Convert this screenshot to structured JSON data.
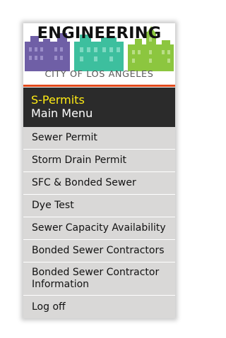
{
  "logo": {
    "word": "ENGINEERING",
    "city": "CITY OF LOS ANGELES",
    "colors": {
      "purple": "#6f5fa6",
      "teal": "#3dbf9e",
      "green": "#8cc63f",
      "rule": "#e24a1c"
    }
  },
  "header": {
    "app_name": "S-Permits",
    "subtitle": "Main Menu",
    "colors": {
      "background": "#2b2b2b",
      "app_name": "#ffeb14",
      "subtitle": "#ffffff"
    }
  },
  "menu": {
    "items": [
      {
        "label": "Sewer Permit"
      },
      {
        "label": "Storm Drain Permit"
      },
      {
        "label": "SFC & Bonded Sewer"
      },
      {
        "label": "Dye Test"
      },
      {
        "label": "Sewer Capacity Availability"
      },
      {
        "label": "Bonded Sewer Contractors"
      },
      {
        "label": "Bonded Sewer Contractor Information"
      },
      {
        "label": "Log off"
      }
    ],
    "colors": {
      "background": "#d9d8d7",
      "divider": "#ffffff"
    }
  }
}
